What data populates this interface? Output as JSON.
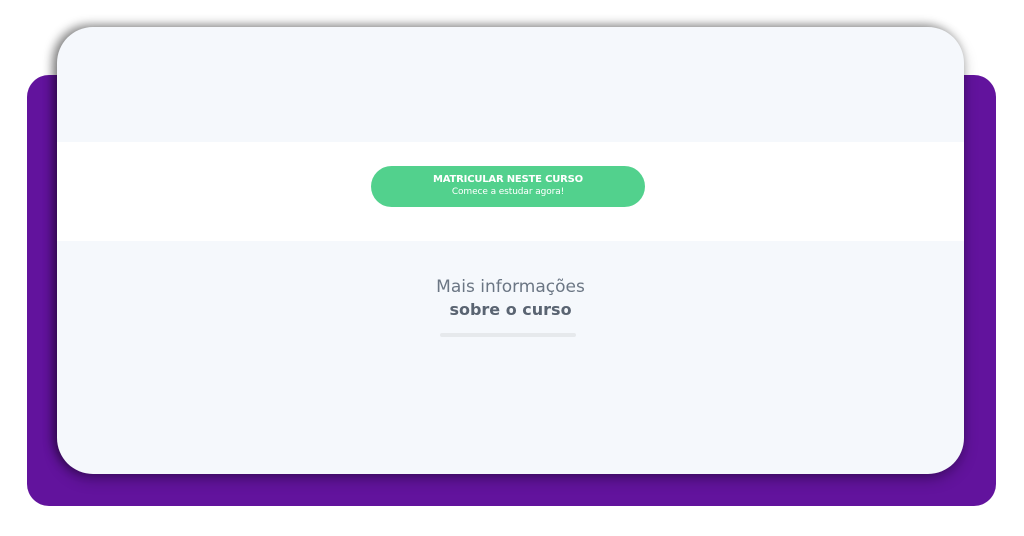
{
  "colors": {
    "purple": "#62139d",
    "card_bg": "#f5f8fc",
    "band_bg": "#ffffff",
    "button_green": "#52d18d",
    "text_gray": "#6b7684",
    "text_gray_dark": "#5a6472",
    "divider_gray": "#e6e9ec"
  },
  "enroll": {
    "title": "MATRICULAR NESTE CURSO",
    "subtitle": "Comece a estudar agora!"
  },
  "info": {
    "line1": "Mais informações",
    "line2": "sobre o curso"
  }
}
